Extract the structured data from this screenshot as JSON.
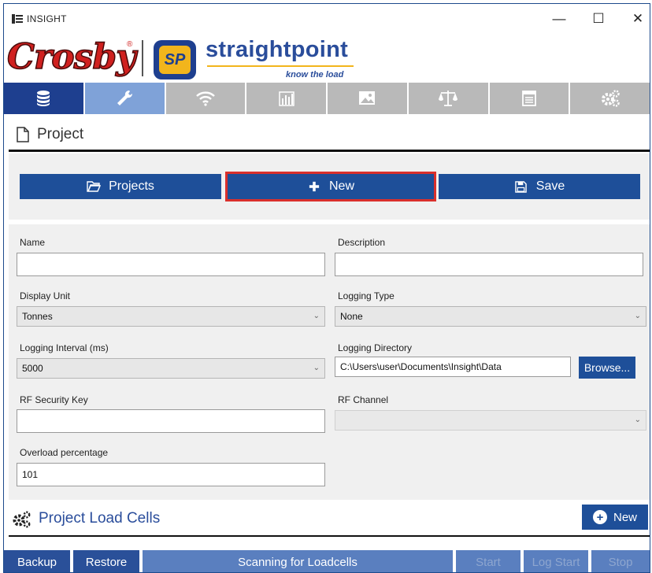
{
  "window": {
    "title": "INSIGHT",
    "controls": {
      "minimize": "—",
      "maximize": "☐",
      "close": "✕"
    }
  },
  "brand": {
    "crosby": "Crosby",
    "reg": "®",
    "straightpoint": "straightpoint",
    "sp_mark": "SP",
    "tagline": "know the load"
  },
  "tabs": [
    {
      "icon": "database-icon"
    },
    {
      "icon": "wrench-icon"
    },
    {
      "icon": "wifi-icon"
    },
    {
      "icon": "bar-chart-icon"
    },
    {
      "icon": "image-icon"
    },
    {
      "icon": "scale-icon"
    },
    {
      "icon": "calendar-icon"
    },
    {
      "icon": "gears-icon"
    }
  ],
  "project": {
    "title": "Project",
    "buttons": {
      "projects": "Projects",
      "new": "New",
      "save": "Save"
    }
  },
  "form": {
    "name_label": "Name",
    "name_value": "",
    "description_label": "Description",
    "description_value": "",
    "display_unit_label": "Display Unit",
    "display_unit_value": "Tonnes",
    "logging_type_label": "Logging Type",
    "logging_type_value": "None",
    "logging_interval_label": "Logging Interval (ms)",
    "logging_interval_value": "5000",
    "logging_directory_label": "Logging Directory",
    "logging_directory_value": "C:\\Users\\user\\Documents\\Insight\\Data",
    "browse_label": "Browse...",
    "rf_key_label": "RF Security Key",
    "rf_key_value": "",
    "rf_channel_label": "RF Channel",
    "rf_channel_value": "",
    "overload_label": "Overload percentage",
    "overload_value": "101"
  },
  "load_cells": {
    "title": "Project Load Cells",
    "new_label": "New"
  },
  "bottom": {
    "backup": "Backup",
    "restore": "Restore",
    "status": "Scanning for Loadcells",
    "start": "Start",
    "log_start": "Log Start",
    "stop": "Stop"
  },
  "colors": {
    "accent": "#1e4f99",
    "tab_active": "#1e3f8f",
    "tab_selected": "#7fa2d8",
    "highlight": "#d9302c",
    "crosby_red": "#d0201f",
    "sp_yellow": "#f2b51c"
  }
}
